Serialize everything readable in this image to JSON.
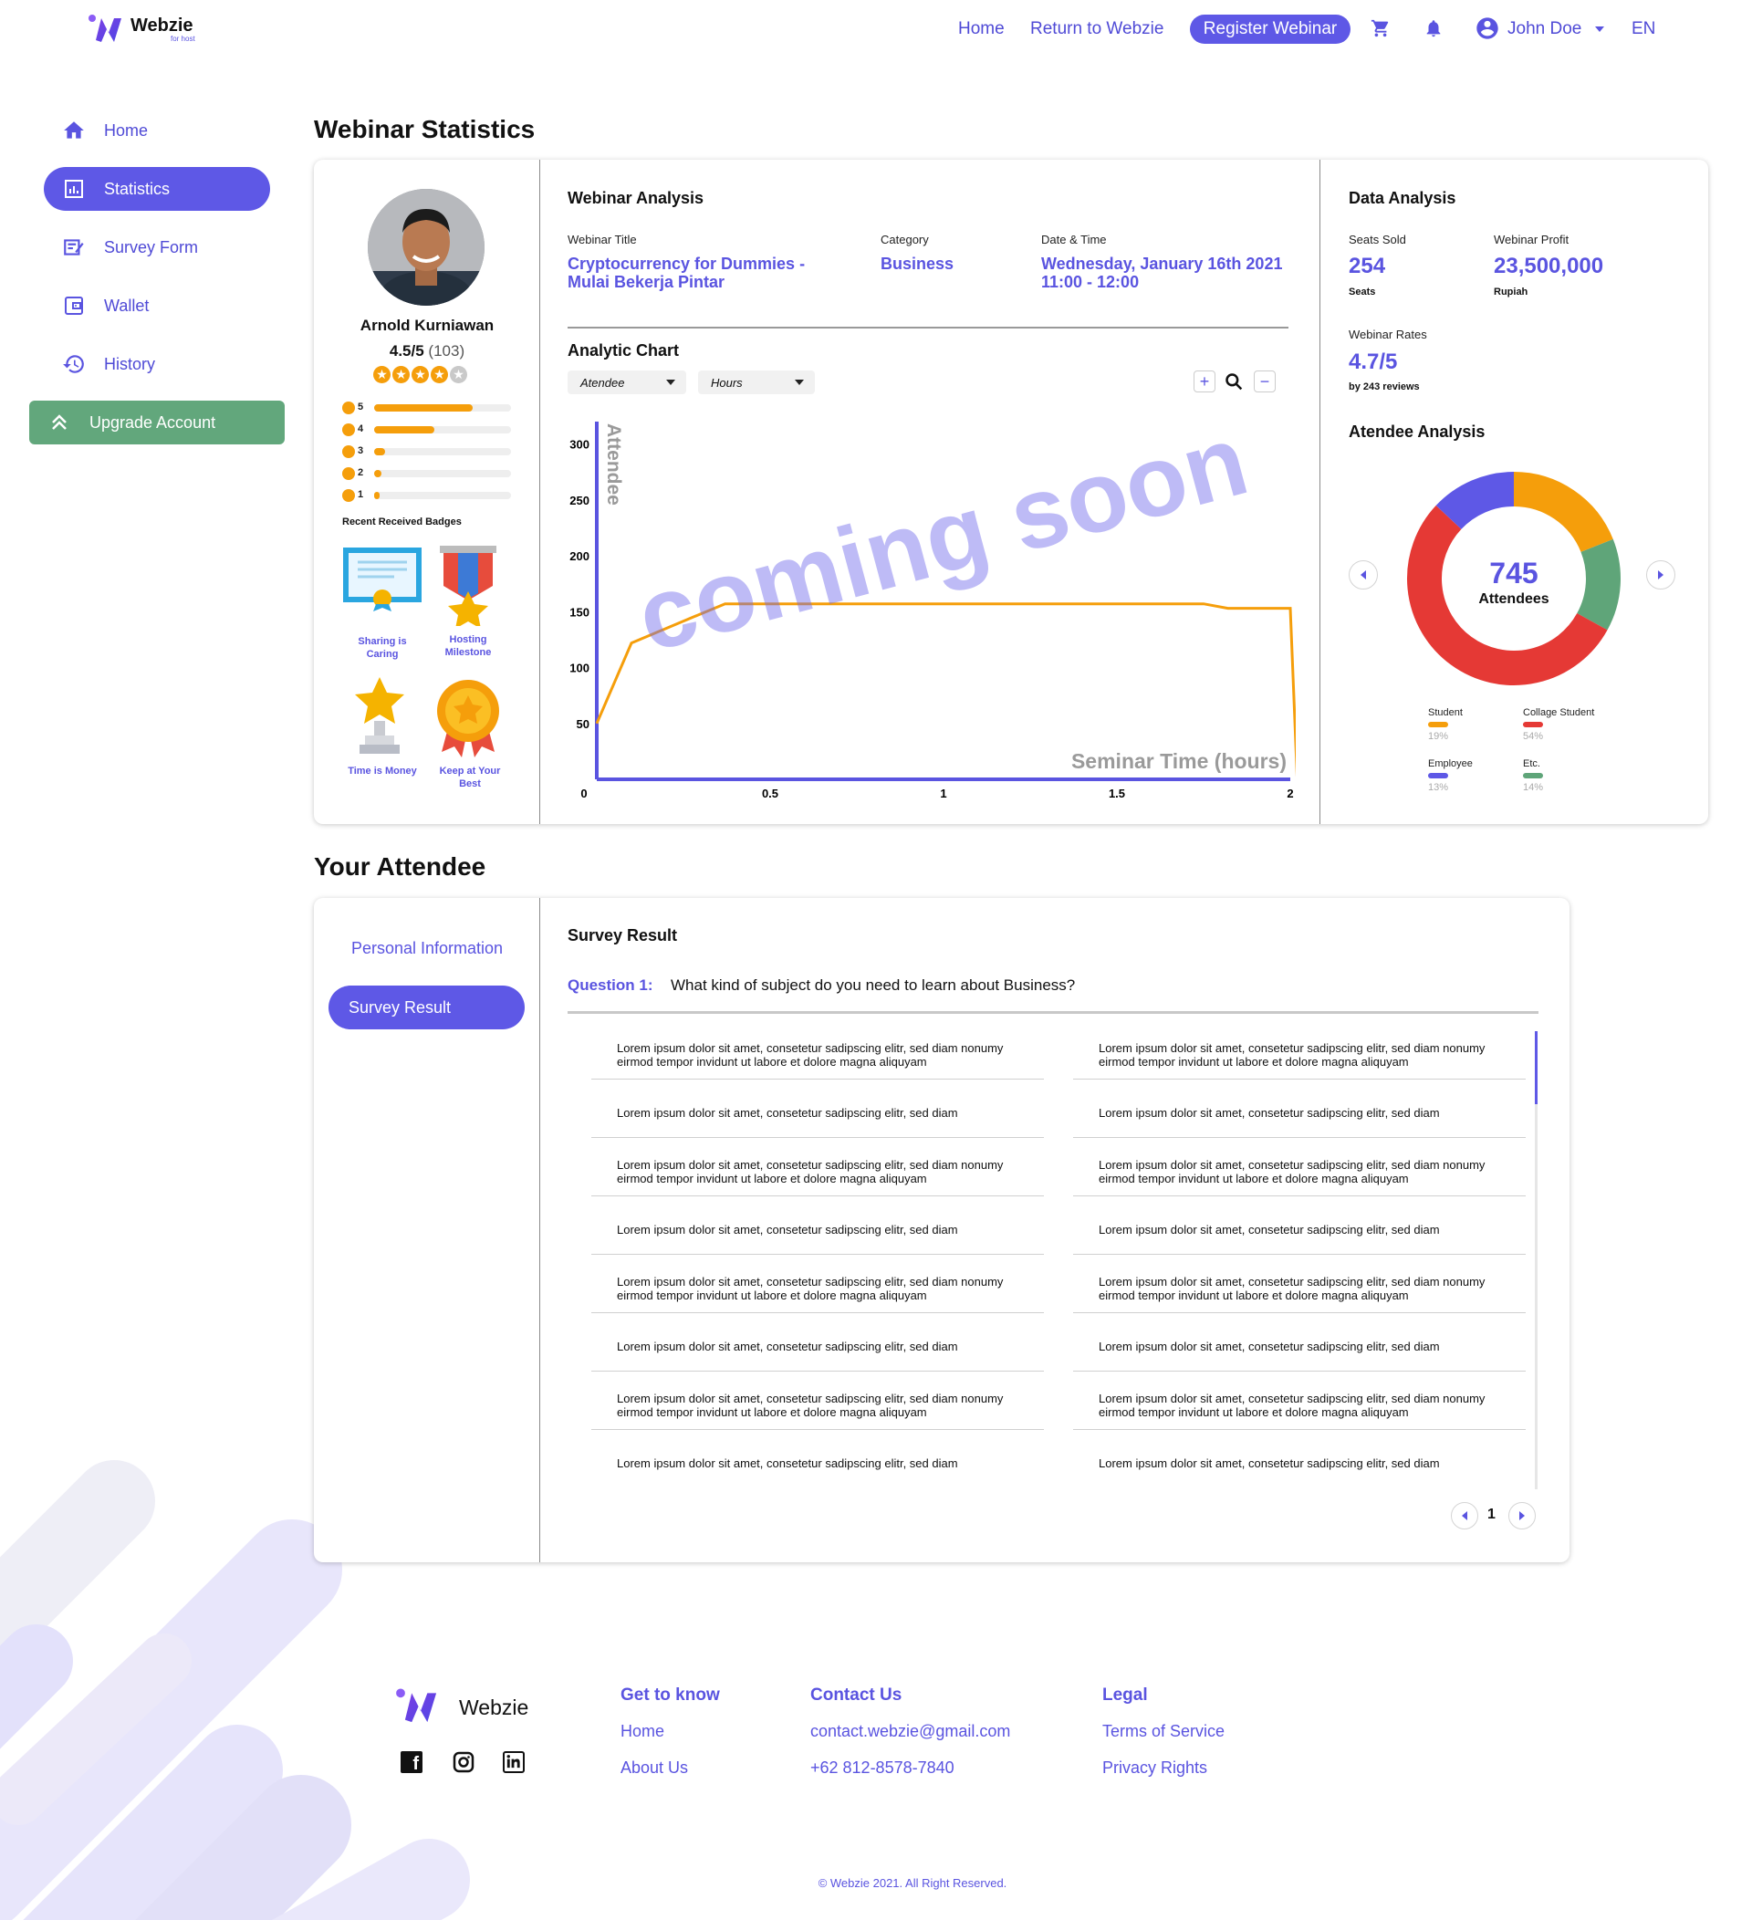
{
  "brand": {
    "name": "Webzie",
    "tagline": "for host"
  },
  "nav": {
    "home": "Home",
    "return": "Return to Webzie",
    "register": "Register Webinar",
    "user": "John Doe",
    "lang": "EN"
  },
  "sidebar": {
    "items": [
      {
        "label": "Home",
        "icon": "home-icon"
      },
      {
        "label": "Statistics",
        "icon": "statistics-icon"
      },
      {
        "label": "Survey Form",
        "icon": "survey-form-icon"
      },
      {
        "label": "Wallet",
        "icon": "wallet-icon"
      },
      {
        "label": "History",
        "icon": "history-icon"
      },
      {
        "label": "Upgrade Account",
        "icon": "upgrade-icon"
      }
    ]
  },
  "stats": {
    "title": "Webinar Statistics",
    "profile": {
      "name": "Arnold Kurniawan",
      "rating": "4.5/5",
      "count": "(103)",
      "stars": 4.5,
      "breakdown": [
        {
          "star": "5",
          "fill": 0.72
        },
        {
          "star": "4",
          "fill": 0.44
        },
        {
          "star": "3",
          "fill": 0.08
        },
        {
          "star": "2",
          "fill": 0.05
        },
        {
          "star": "1",
          "fill": 0.04
        }
      ],
      "badges_title": "Recent Received Badges",
      "badges": [
        "Sharing is Caring",
        "Hosting Milestone",
        "Time is Money",
        "Keep at Your Best"
      ]
    },
    "analysis": {
      "title": "Webinar Analysis",
      "webinar_title_label": "Webinar Title",
      "webinar_title": "Cryptocurrency for Dummies - Mulai Bekerja Pintar",
      "category_label": "Category",
      "category": "Business",
      "datetime_label": "Date & Time",
      "date": "Wednesday, January 16th 2021",
      "time": "11:00 - 12:00",
      "chart_title": "Analytic Chart",
      "dropdown1": "Atendee",
      "dropdown2": "Hours",
      "overlay": "coming soon"
    },
    "data_analysis": {
      "title": "Data Analysis",
      "seats_label": "Seats Sold",
      "seats_value": "254",
      "seats_unit": "Seats",
      "profit_label": "Webinar Profit",
      "profit_value": "23,500,000",
      "profit_unit": "Rupiah",
      "rates_label": "Webinar Rates",
      "rates_value": "4.7/5",
      "rates_reviews": "by 243 reviews",
      "attendee_title": "Atendee Analysis",
      "total": "745",
      "total_label": "Attendees",
      "legend": [
        {
          "name": "Student",
          "pct": "19%",
          "color": "#f59e0b"
        },
        {
          "name": "Collage Student",
          "pct": "54%",
          "color": "#e53935"
        },
        {
          "name": "Employee",
          "pct": "13%",
          "color": "#5e58e6"
        },
        {
          "name": "Etc.",
          "pct": "14%",
          "color": "#5fa579"
        }
      ]
    }
  },
  "chart_data": {
    "type": "line",
    "title": "",
    "xlabel": "Seminar Time (hours)",
    "ylabel": "Attendee",
    "xlim": [
      0,
      2
    ],
    "ylim": [
      0,
      320
    ],
    "x_ticks": [
      "0",
      "0.5",
      "1",
      "1.5",
      "2"
    ],
    "y_ticks": [
      "50",
      "100",
      "150",
      "200",
      "250",
      "300"
    ],
    "series": [
      {
        "x": [
          0,
          0.1,
          0.3,
          0.37,
          1.0,
          1.75,
          1.82,
          2.0,
          2.02
        ],
        "y": [
          50,
          122,
          148,
          157,
          157,
          157,
          153,
          153,
          0
        ]
      }
    ]
  },
  "attendee": {
    "title": "Your Attendee",
    "tab_personal": "Personal Information",
    "tab_survey": "Survey Result",
    "survey_title": "Survey Result",
    "q_label": "Question 1:",
    "q_text": "What kind of subject do you need to learn about Business?",
    "rows": [
      {
        "a": "Lorem ipsum dolor sit amet, consetetur sadipscing elitr, sed diam nonumy eirmod tempor invidunt ut labore et dolore magna aliquyam",
        "b": "Lorem ipsum dolor sit amet, consetetur sadipscing elitr, sed diam nonumy eirmod tempor invidunt ut labore et dolore magna aliquyam"
      },
      {
        "a": "Lorem ipsum dolor sit amet, consetetur sadipscing elitr, sed diam",
        "b": "Lorem ipsum dolor sit amet, consetetur sadipscing elitr, sed diam"
      },
      {
        "a": "Lorem ipsum dolor sit amet, consetetur sadipscing elitr, sed diam nonumy eirmod tempor invidunt ut labore et dolore magna aliquyam",
        "b": "Lorem ipsum dolor sit amet, consetetur sadipscing elitr, sed diam nonumy eirmod tempor invidunt ut labore et dolore magna aliquyam"
      },
      {
        "a": "Lorem ipsum dolor sit amet, consetetur sadipscing elitr, sed diam",
        "b": "Lorem ipsum dolor sit amet, consetetur sadipscing elitr, sed diam"
      },
      {
        "a": "Lorem ipsum dolor sit amet, consetetur sadipscing elitr, sed diam nonumy eirmod tempor invidunt ut labore et dolore magna aliquyam",
        "b": "Lorem ipsum dolor sit amet, consetetur sadipscing elitr, sed diam nonumy eirmod tempor invidunt ut labore et dolore magna aliquyam"
      },
      {
        "a": "Lorem ipsum dolor sit amet, consetetur sadipscing elitr, sed diam",
        "b": "Lorem ipsum dolor sit amet, consetetur sadipscing elitr, sed diam"
      },
      {
        "a": "Lorem ipsum dolor sit amet, consetetur sadipscing elitr, sed diam nonumy eirmod tempor invidunt ut labore et dolore magna aliquyam",
        "b": "Lorem ipsum dolor sit amet, consetetur sadipscing elitr, sed diam nonumy eirmod tempor invidunt ut labore et dolore magna aliquyam"
      },
      {
        "a": "Lorem ipsum dolor sit amet, consetetur sadipscing elitr, sed diam",
        "b": "Lorem ipsum dolor sit amet, consetetur sadipscing elitr, sed diam"
      }
    ],
    "page": "1"
  },
  "footer": {
    "brand": "Webzie",
    "col1_title": "Get to know",
    "col1_a": "Home",
    "col1_b": "About Us",
    "col2_title": "Contact Us",
    "col2_a": "contact.webzie@gmail.com",
    "col2_b": "+62 812-8578-7840",
    "col3_title": "Legal",
    "col3_a": "Terms of Service",
    "col3_b": "Privacy Rights",
    "copyright": "© Webzie 2021. All Right Reserved."
  }
}
